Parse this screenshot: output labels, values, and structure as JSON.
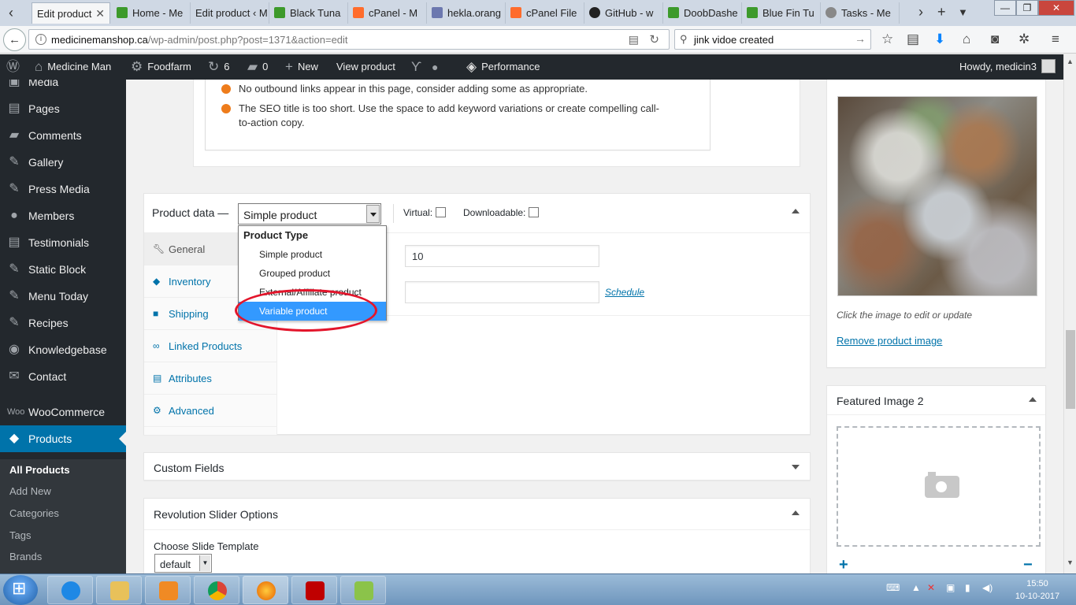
{
  "browser": {
    "tabs": [
      {
        "label": "Edit product",
        "favicon_color": "#ffffff"
      },
      {
        "label": "Home - Me",
        "favicon_color": "#3d9a2b"
      },
      {
        "label": "Edit product ‹ M",
        "favicon_color": "#ffffff"
      },
      {
        "label": "Black Tuna",
        "favicon_color": "#3d9a2b"
      },
      {
        "label": "cPanel - M",
        "favicon_color": "#ff6c2c"
      },
      {
        "label": "hekla.orang",
        "favicon_color": "#6c78af"
      },
      {
        "label": "cPanel File",
        "favicon_color": "#ff6c2c"
      },
      {
        "label": "GitHub - w",
        "favicon_color": "#222222"
      },
      {
        "label": "DoobDashe",
        "favicon_color": "#3d9a2b"
      },
      {
        "label": "Blue Fin Tu",
        "favicon_color": "#3d9a2b"
      },
      {
        "label": "Tasks - Me",
        "favicon_color": "#888888"
      }
    ],
    "url_host": "medicinemanshop.ca",
    "url_path": "/wp-admin/post.php?post=1371&action=edit",
    "search_text": "jink vidoe created"
  },
  "adminbar": {
    "site_name": "Medicine Man",
    "theme": "Foodfarm",
    "updates_count": "6",
    "comments_count": "0",
    "new_label": "New",
    "view_product": "View product",
    "performance": "Performance",
    "howdy": "Howdy, medicin3"
  },
  "sidebar": {
    "items": [
      {
        "label": "Media",
        "icon": "media-icon"
      },
      {
        "label": "Pages",
        "icon": "pages-icon"
      },
      {
        "label": "Comments",
        "icon": "comments-icon"
      },
      {
        "label": "Gallery",
        "icon": "pin-icon"
      },
      {
        "label": "Press Media",
        "icon": "pin-icon"
      },
      {
        "label": "Members",
        "icon": "members-icon"
      },
      {
        "label": "Testimonials",
        "icon": "testimonials-icon"
      },
      {
        "label": "Static Block",
        "icon": "pin-icon"
      },
      {
        "label": "Menu Today",
        "icon": "pin-icon"
      },
      {
        "label": "Recipes",
        "icon": "pin-icon"
      },
      {
        "label": "Knowledgebase",
        "icon": "knowledgebase-icon"
      },
      {
        "label": "Contact",
        "icon": "contact-icon"
      },
      {
        "label": "WooCommerce",
        "icon": "woocommerce-icon"
      },
      {
        "label": "Products",
        "icon": "products-icon"
      }
    ],
    "submenu": [
      "All Products",
      "Add New",
      "Categories",
      "Tags",
      "Brands"
    ]
  },
  "seo": {
    "items": [
      "No outbound links appear in this page, consider adding some as appropriate.",
      "The SEO title is too short. Use the space to add keyword variations or create compelling call-to-action copy."
    ],
    "dot_color": "#ee7c1b"
  },
  "product_data": {
    "title": "Product data —",
    "selected_type": "Simple product",
    "virtual_label": "Virtual:",
    "downloadable_label": "Downloadable:",
    "tabs": [
      "General",
      "Inventory",
      "Shipping",
      "Linked Products",
      "Attributes",
      "Advanced"
    ],
    "regular_price_value": "10",
    "sale_price_value": "",
    "schedule_link": "Schedule",
    "dropdown": {
      "group_label": "Product Type",
      "options": [
        "Simple product",
        "Grouped product",
        "External/Affiliate product",
        "Variable product"
      ],
      "highlighted": "Variable product"
    }
  },
  "custom_fields": {
    "title": "Custom Fields"
  },
  "revolution": {
    "title": "Revolution Slider Options",
    "template_label": "Choose Slide Template",
    "template_value": "default"
  },
  "product_image": {
    "hint": "Click the image to edit or update",
    "remove_link": "Remove product image"
  },
  "featured2": {
    "title": "Featured Image 2"
  },
  "taskbar": {
    "time": "15:50",
    "date": "10-10-2017"
  },
  "colors": {
    "wp_admin_dark": "#23282d",
    "wp_blue": "#0073aa",
    "highlight": "#3399ff",
    "annotation": "#e3152b"
  }
}
